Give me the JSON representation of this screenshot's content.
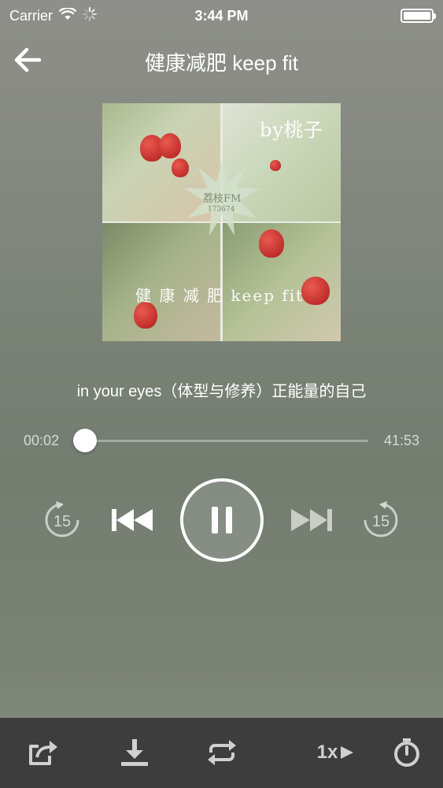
{
  "status_bar": {
    "carrier": "Carrier",
    "time": "3:44 PM",
    "icons": [
      "wifi-icon",
      "activity-spinner-icon",
      "battery-icon"
    ]
  },
  "nav": {
    "title": "健康减肥 keep fit",
    "back_icon": "arrow-left-icon"
  },
  "cover": {
    "overlay_text_top": "by桃子",
    "overlay_badge": "荔枝FM",
    "overlay_badge_sub": "173674",
    "overlay_text_bottom": "健 康 减 肥 keep fit"
  },
  "track": {
    "title": "in your eyes（体型与修养）正能量的自己"
  },
  "progress": {
    "current": "00:02",
    "total": "41:53",
    "fraction": 0.0008
  },
  "controls": {
    "rewind_seconds": "15",
    "forward_seconds": "15",
    "icons": [
      "rewind-15-icon",
      "previous-track-icon",
      "pause-icon",
      "next-track-icon",
      "forward-15-icon"
    ]
  },
  "bottom_bar": {
    "speed_label": "1x",
    "icons": [
      "share-icon",
      "download-icon",
      "repeat-icon",
      "speed-play-icon",
      "timer-icon"
    ]
  },
  "colors": {
    "bottom_bar_bg": "#3d3d3d",
    "icon_light": "#ffffff",
    "icon_muted": "#d0d0d0"
  }
}
